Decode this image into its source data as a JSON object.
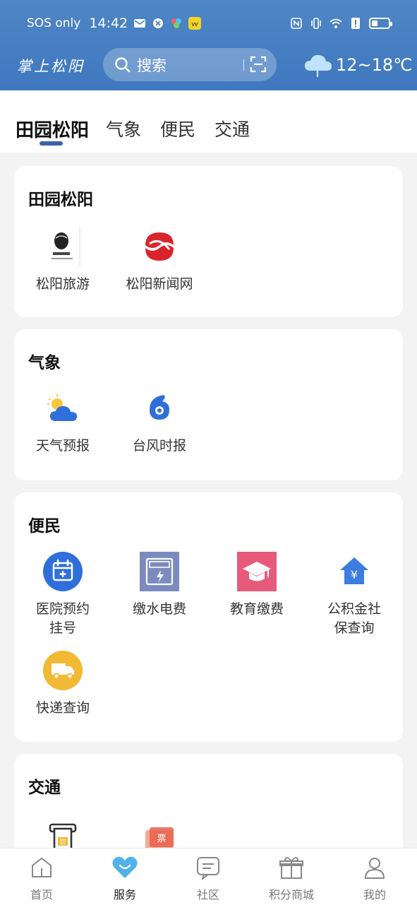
{
  "status_bar": {
    "carrier": "SOS only",
    "time": "14:42"
  },
  "header": {
    "brand": "掌上松阳",
    "search_placeholder": "搜索",
    "weather_temp": "12~18℃"
  },
  "tabs": [
    {
      "label": "田园松阳",
      "active": true
    },
    {
      "label": "气象",
      "active": false
    },
    {
      "label": "便民",
      "active": false
    },
    {
      "label": "交通",
      "active": false
    }
  ],
  "sections": {
    "tianyuan": {
      "title": "田园松阳",
      "items": [
        {
          "label": "松阳旅游",
          "icon": "songyang-travel-logo"
        },
        {
          "label": "松阳新闻网",
          "icon": "songyang-news-logo"
        }
      ]
    },
    "qixiang": {
      "title": "气象",
      "items": [
        {
          "label": "天气预报",
          "icon": "sun-cloud-icon"
        },
        {
          "label": "台风时报",
          "icon": "typhoon-icon"
        }
      ]
    },
    "bianmin": {
      "title": "便民",
      "items": [
        {
          "label": "医院预约挂号",
          "line1": "医院预约",
          "line2": "挂号",
          "icon": "calendar-plus-icon"
        },
        {
          "label": "缴水电费",
          "icon": "electric-meter-icon"
        },
        {
          "label": "教育缴费",
          "icon": "graduation-cap-icon"
        },
        {
          "label": "公积金社保查询",
          "line1": "公积金社",
          "line2": "保查询",
          "icon": "house-yen-icon"
        },
        {
          "label": "快递查询",
          "icon": "delivery-truck-icon"
        }
      ]
    },
    "jiaotong": {
      "title": "交通",
      "items": [
        {
          "label": "",
          "icon": "fine-receipt-icon",
          "badge": "罚"
        },
        {
          "label": "",
          "icon": "ticket-icon",
          "badge": "票"
        }
      ]
    }
  },
  "bottom_nav": [
    {
      "label": "首页",
      "icon": "home-icon",
      "active": false
    },
    {
      "label": "服务",
      "icon": "heart-service-icon",
      "active": true
    },
    {
      "label": "社区",
      "icon": "chat-icon",
      "active": false
    },
    {
      "label": "积分商城",
      "icon": "gift-icon",
      "active": false
    },
    {
      "label": "我的",
      "icon": "user-icon",
      "active": false
    }
  ],
  "colors": {
    "header": "#4680c4",
    "accent": "#3a62a8",
    "hospital": "#2f6fdc",
    "education": "#e85a7a",
    "express": "#f2b934",
    "housing": "#3b7de0",
    "nav_active": "#4fb2ea"
  }
}
